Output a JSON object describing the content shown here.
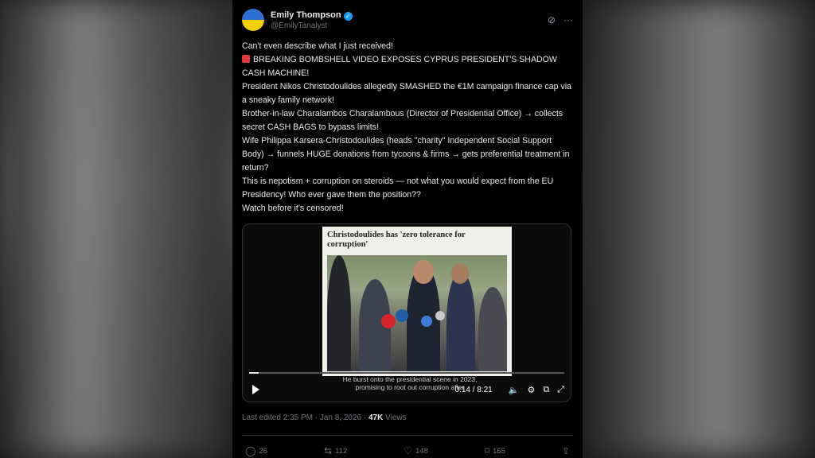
{
  "author": {
    "display_name": "Emily Thompson",
    "handle": "@EmilyTanalyst"
  },
  "icons": {
    "avatar": "flag-avatar",
    "verified": "verified-badge-icon",
    "grok": "grok-icon",
    "more": "more-icon"
  },
  "tweet": {
    "lines": [
      "Can't even describe what I just received!",
      "BREAKING BOMBSHELL VIDEO EXPOSES CYPRUS PRESIDENT'S SHADOW CASH MACHINE!",
      "President Nikos Christodoulides allegedly SMASHED the €1M campaign finance cap via a sneaky family network!",
      "Brother-in-law Charalambos Charalambous (Director of Presidential Office) → collects secret CASH BAGS to bypass limits!",
      "Wife Philippa Karsera-Christodoulides (heads \"charity\" Independent Social Support Body) → funnels HUGE donations from tycoons & firms → gets preferential treatment in return?",
      "This is nepotism + corruption on steroids — not what you would expect from the EU Presidency! Who ever gave them the position??",
      "Watch before it's censored!"
    ]
  },
  "video": {
    "article_title": "Christodoulides has 'zero tolerance for corruption'",
    "caption_line1": "He burst onto the presidential scene in 2023,",
    "caption_line2": "promising to root out corruption after",
    "time": "0:14 / 8:21",
    "progress_fraction": 0.03
  },
  "meta": {
    "edited": "Last edited 2:35 PM · Jan 8, 2026 · ",
    "views_count": "47K",
    "views_label": " Views"
  },
  "actions": {
    "replies": "26",
    "reposts": "112",
    "likes": "148",
    "bookmarks": "165"
  }
}
